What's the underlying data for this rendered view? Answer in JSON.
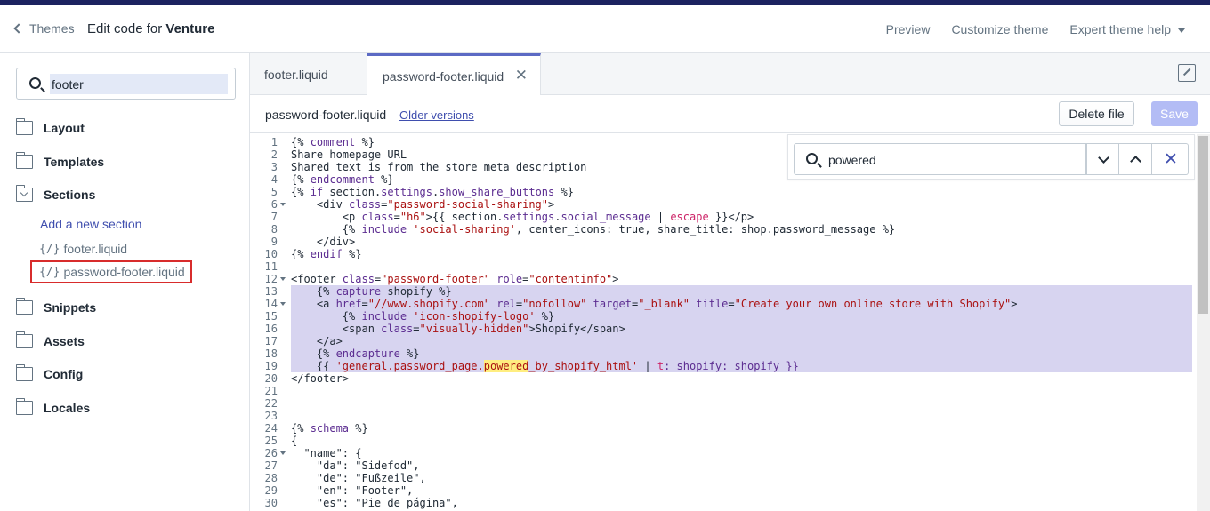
{
  "header": {
    "back_label": "Themes",
    "title_prefix": "Edit code for ",
    "theme_name": "Venture",
    "actions": [
      "Preview",
      "Customize theme",
      "Expert theme help"
    ]
  },
  "sidebar": {
    "search_value": "footer",
    "folders": {
      "layout": "Layout",
      "templates": "Templates",
      "sections": "Sections",
      "snippets": "Snippets",
      "assets": "Assets",
      "config": "Config",
      "locales": "Locales"
    },
    "add_section": "Add a new section",
    "files": [
      "footer.liquid",
      "password-footer.liquid"
    ],
    "file_icon_glyph": "{/}"
  },
  "tabs": {
    "tab1": "footer.liquid",
    "tab2": "password-footer.liquid",
    "close_glyph": "✕"
  },
  "filebar": {
    "file_name": "password-footer.liquid",
    "older_versions": "Older versions",
    "delete_label": "Delete file",
    "save_label": "Save"
  },
  "find": {
    "query": "powered",
    "close_glyph": "✕"
  },
  "editor": {
    "line_numbers": [
      "1",
      "2",
      "3",
      "4",
      "5",
      "6",
      "7",
      "8",
      "9",
      "10",
      "11",
      "12",
      "13",
      "14",
      "15",
      "16",
      "17",
      "18",
      "19",
      "20",
      "21",
      "22",
      "23",
      "24",
      "25",
      "26",
      "27",
      "28",
      "29",
      "30"
    ],
    "fold_lines": [
      6,
      12,
      14,
      26
    ],
    "selected_lines": [
      13,
      14,
      15,
      16,
      17,
      18,
      19
    ],
    "lines": [
      [
        [
          "{% ",
          "#212b36"
        ],
        [
          "comment",
          "#5c2d91"
        ],
        [
          " %}",
          "#212b36"
        ]
      ],
      [
        [
          "Share homepage URL",
          "#212b36"
        ]
      ],
      [
        [
          "Shared text is from the store meta description",
          "#212b36"
        ]
      ],
      [
        [
          "{% ",
          "#212b36"
        ],
        [
          "endcomment",
          "#5c2d91"
        ],
        [
          " %}",
          "#212b36"
        ]
      ],
      [
        [
          "{% ",
          "#212b36"
        ],
        [
          "if",
          "#5c2d91"
        ],
        [
          " section.",
          "#212b36"
        ],
        [
          "settings",
          "#5c2d91"
        ],
        [
          ".",
          "#212b36"
        ],
        [
          "show_share_buttons",
          "#5c2d91"
        ],
        [
          " %}",
          "#212b36"
        ]
      ],
      [
        [
          "    <div ",
          "#212b36"
        ],
        [
          "class",
          "#5c2d91"
        ],
        [
          "=",
          "#212b36"
        ],
        [
          "\"password-social-sharing\"",
          "#a11"
        ],
        [
          ">",
          "#212b36"
        ]
      ],
      [
        [
          "        <p ",
          "#212b36"
        ],
        [
          "class",
          "#5c2d91"
        ],
        [
          "=",
          "#212b36"
        ],
        [
          "\"h6\"",
          "#a11"
        ],
        [
          ">{{ section.",
          "#212b36"
        ],
        [
          "settings",
          "#5c2d91"
        ],
        [
          ".",
          "#212b36"
        ],
        [
          "social_message",
          "#5c2d91"
        ],
        [
          " | ",
          "#212b36"
        ],
        [
          "escape",
          "#c26"
        ],
        [
          " }}</p>",
          "#212b36"
        ]
      ],
      [
        [
          "        {% ",
          "#212b36"
        ],
        [
          "include",
          "#5c2d91"
        ],
        [
          " ",
          "#212b36"
        ],
        [
          "'social-sharing'",
          "#a11"
        ],
        [
          ", center_icons: true, share_title: shop.password_message %}",
          "#212b36"
        ]
      ],
      [
        [
          "    </div>",
          "#212b36"
        ]
      ],
      [
        [
          "{% ",
          "#212b36"
        ],
        [
          "endif",
          "#5c2d91"
        ],
        [
          " %}",
          "#212b36"
        ]
      ],
      [
        [
          "",
          "#212b36"
        ]
      ],
      [
        [
          "<footer ",
          "#212b36"
        ],
        [
          "class",
          "#5c2d91"
        ],
        [
          "=",
          "#212b36"
        ],
        [
          "\"password-footer\"",
          "#a11"
        ],
        [
          " ",
          "#212b36"
        ],
        [
          "role",
          "#5c2d91"
        ],
        [
          "=",
          "#212b36"
        ],
        [
          "\"contentinfo\"",
          "#a11"
        ],
        [
          ">",
          "#212b36"
        ]
      ],
      [
        [
          "    {% ",
          "#212b36"
        ],
        [
          "capture",
          "#5c2d91"
        ],
        [
          " shopify %}",
          "#212b36"
        ]
      ],
      [
        [
          "    <a ",
          "#212b36"
        ],
        [
          "href",
          "#5c2d91"
        ],
        [
          "=",
          "#212b36"
        ],
        [
          "\"//www.shopify.com\"",
          "#a11"
        ],
        [
          " ",
          "#212b36"
        ],
        [
          "rel",
          "#5c2d91"
        ],
        [
          "=",
          "#212b36"
        ],
        [
          "\"nofollow\"",
          "#a11"
        ],
        [
          " ",
          "#212b36"
        ],
        [
          "target",
          "#5c2d91"
        ],
        [
          "=",
          "#212b36"
        ],
        [
          "\"_blank\"",
          "#a11"
        ],
        [
          " ",
          "#212b36"
        ],
        [
          "title",
          "#5c2d91"
        ],
        [
          "=",
          "#212b36"
        ],
        [
          "\"Create your own online store with Shopify\"",
          "#a11"
        ],
        [
          ">",
          "#212b36"
        ]
      ],
      [
        [
          "        {% ",
          "#212b36"
        ],
        [
          "include",
          "#5c2d91"
        ],
        [
          " ",
          "#212b36"
        ],
        [
          "'icon-shopify-logo'",
          "#a11"
        ],
        [
          " %}",
          "#212b36"
        ]
      ],
      [
        [
          "        <span ",
          "#212b36"
        ],
        [
          "class",
          "#5c2d91"
        ],
        [
          "=",
          "#212b36"
        ],
        [
          "\"visually-hidden\"",
          "#a11"
        ],
        [
          ">Shopify</span>",
          "#212b36"
        ]
      ],
      [
        [
          "    </a>",
          "#212b36"
        ]
      ],
      [
        [
          "    {% ",
          "#212b36"
        ],
        [
          "endcapture",
          "#5c2d91"
        ],
        [
          " %}",
          "#212b36"
        ]
      ],
      [
        [
          "    {{ ",
          "#212b36"
        ],
        [
          "'general.password_page.",
          "#a11"
        ],
        [
          "powered",
          "#a11",
          "hl"
        ],
        [
          "_by_shopify_html'",
          "#a11"
        ],
        [
          " | ",
          "#212b36"
        ],
        [
          "t",
          "#c26"
        ],
        [
          ": shopify: shopify }}",
          "#5c2d91"
        ]
      ],
      [
        [
          "</footer>",
          "#212b36"
        ]
      ],
      [
        [
          "",
          "#212b36"
        ]
      ],
      [
        [
          "",
          "#212b36"
        ]
      ],
      [
        [
          "",
          "#212b36"
        ]
      ],
      [
        [
          "{% ",
          "#212b36"
        ],
        [
          "schema",
          "#5c2d91"
        ],
        [
          " %}",
          "#212b36"
        ]
      ],
      [
        [
          "{",
          "#212b36"
        ]
      ],
      [
        [
          "  \"name\": {",
          "#212b36"
        ]
      ],
      [
        [
          "    \"da\": \"Sidefod\",",
          "#212b36"
        ]
      ],
      [
        [
          "    \"de\": \"Fußzeile\",",
          "#212b36"
        ]
      ],
      [
        [
          "    \"en\": \"Footer\",",
          "#212b36"
        ]
      ],
      [
        [
          "    \"es\": \"Pie de página\",",
          "#212b36"
        ]
      ]
    ]
  },
  "colors": {
    "accent": "#5c6ac4",
    "link": "#3f4eae",
    "selection": "#d7d4f0",
    "match_highlight": "#ffee80",
    "selected_file_border": "#d82c2c"
  }
}
